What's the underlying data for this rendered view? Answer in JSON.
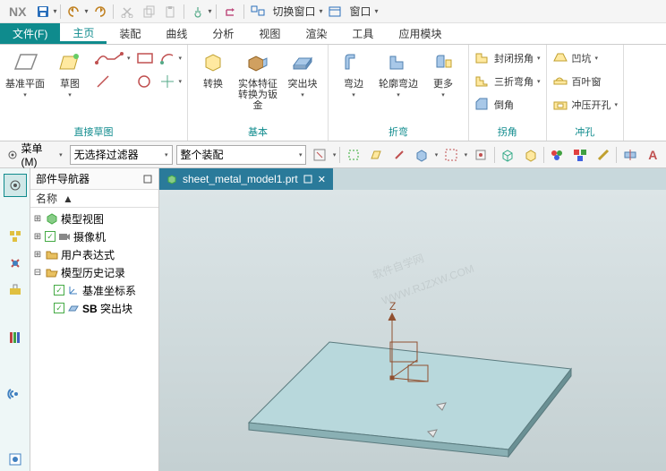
{
  "app": {
    "name": "NX"
  },
  "titlebar": {
    "switch_window": "切换窗口",
    "window_menu": "窗口"
  },
  "menu": {
    "file": "文件(F)",
    "home": "主页",
    "assembly": "装配",
    "curve": "曲线",
    "analyze": "分析",
    "view": "视图",
    "render": "渲染",
    "tool": "工具",
    "app": "应用模块"
  },
  "ribbon": {
    "datum_plane": "基准平面",
    "sketch": "草图",
    "direct_sketch": "直接草图",
    "convert": "转换",
    "solid_to_sheet": "实体特征转换为钣金",
    "tab": "突出块",
    "base": "基本",
    "flange": "弯边",
    "contour_flange": "轮廓弯边",
    "more": "更多",
    "bend_group": "折弯",
    "closed_corner": "封闭拐角",
    "three_bend": "三折弯角",
    "chamfer": "倒角",
    "corner_group": "拐角",
    "dimple": "凹坑",
    "louver": "百叶窗",
    "punch": "冲压开孔",
    "punch_group": "冲孔"
  },
  "toolrow": {
    "menu_label": "菜单(M)",
    "filter_combo": "无选择过滤器",
    "assembly_combo": "整个装配"
  },
  "nav": {
    "title": "部件导航器",
    "col_name": "名称",
    "tree": {
      "model_view": "模型视图",
      "camera": "摄像机",
      "user_expr": "用户表达式",
      "history": "模型历史记录",
      "datum_csys": "基准坐标系",
      "sb_tab": "SB 突出块",
      "sb_prefix": "SB"
    }
  },
  "tab": {
    "filename": "sheet_metal_model1.prt"
  },
  "axis": {
    "z": "Z"
  },
  "colors": {
    "teal": "#0f8b8d",
    "tab_bg": "#2a7a9a"
  }
}
